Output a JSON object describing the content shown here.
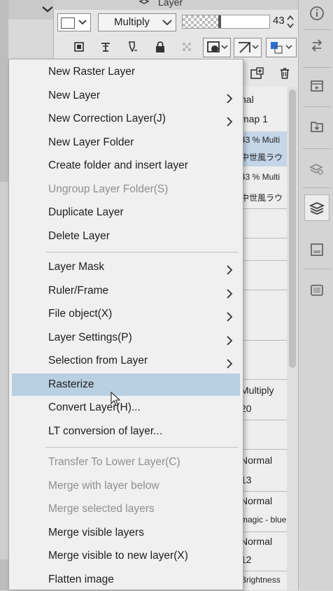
{
  "panel": {
    "title": "Layer"
  },
  "toolbar": {
    "blend_mode": "Multiply",
    "opacity_value": "43",
    "opacity_fraction": 0.43
  },
  "layer_rows": [
    {
      "text": "nal"
    },
    {
      "text": "map 1"
    },
    {
      "text": "43 % Multi",
      "selected": true
    },
    {
      "text": "中世風ラウ",
      "selected": true
    },
    {
      "text": "43 % Multi"
    },
    {
      "text": "中世風ラウ"
    },
    {
      "text": "Multiply"
    },
    {
      "text": "20"
    },
    {
      "text": "Normal"
    },
    {
      "text": "13"
    },
    {
      "text": "Normal"
    },
    {
      "text": "magic - blue"
    },
    {
      "text": "Normal"
    },
    {
      "text": "12"
    },
    {
      "text": "Brightness"
    }
  ],
  "menu": {
    "items": [
      {
        "label": "New Raster Layer",
        "submenu": false,
        "disabled": false
      },
      {
        "label": "New Layer",
        "submenu": true,
        "disabled": false
      },
      {
        "label": "New Correction Layer(J)",
        "submenu": true,
        "disabled": false
      },
      {
        "label": "New Layer Folder",
        "submenu": false,
        "disabled": false
      },
      {
        "label": "Create folder and insert layer",
        "submenu": false,
        "disabled": false
      },
      {
        "label": "Ungroup Layer Folder(S)",
        "submenu": false,
        "disabled": true
      },
      {
        "label": "Duplicate Layer",
        "submenu": false,
        "disabled": false
      },
      {
        "label": "Delete Layer",
        "submenu": false,
        "disabled": false
      },
      {
        "label": "Layer Mask",
        "submenu": true,
        "disabled": false
      },
      {
        "label": "Ruler/Frame",
        "submenu": true,
        "disabled": false
      },
      {
        "label": "File object(X)",
        "submenu": true,
        "disabled": false
      },
      {
        "label": "Layer Settings(P)",
        "submenu": true,
        "disabled": false
      },
      {
        "label": "Selection from Layer",
        "submenu": true,
        "disabled": false
      },
      {
        "label": "Rasterize",
        "submenu": false,
        "disabled": false,
        "highlighted": true
      },
      {
        "label": "Convert Layer(H)...",
        "submenu": false,
        "disabled": false
      },
      {
        "label": "LT conversion of layer...",
        "submenu": false,
        "disabled": false
      },
      {
        "label": "Transfer To Lower Layer(C)",
        "submenu": false,
        "disabled": true
      },
      {
        "label": "Merge with layer below",
        "submenu": false,
        "disabled": true
      },
      {
        "label": "Merge selected layers",
        "submenu": false,
        "disabled": true
      },
      {
        "label": "Merge visible layers",
        "submenu": false,
        "disabled": false
      },
      {
        "label": "Merge visible to new layer(X)",
        "submenu": false,
        "disabled": false
      },
      {
        "label": "Flatten image",
        "submenu": false,
        "disabled": false
      }
    ]
  }
}
